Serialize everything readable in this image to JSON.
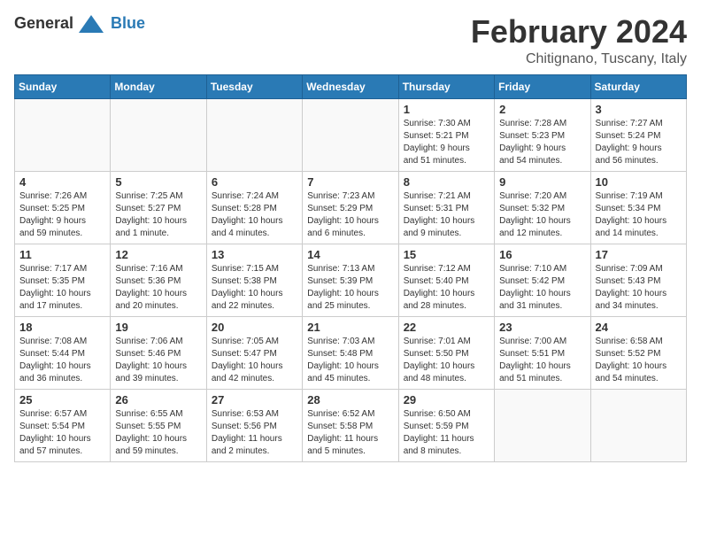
{
  "logo": {
    "general": "General",
    "blue": "Blue"
  },
  "header": {
    "month": "February 2024",
    "location": "Chitignano, Tuscany, Italy"
  },
  "weekdays": [
    "Sunday",
    "Monday",
    "Tuesday",
    "Wednesday",
    "Thursday",
    "Friday",
    "Saturday"
  ],
  "weeks": [
    [
      {
        "day": "",
        "info": ""
      },
      {
        "day": "",
        "info": ""
      },
      {
        "day": "",
        "info": ""
      },
      {
        "day": "",
        "info": ""
      },
      {
        "day": "1",
        "info": "Sunrise: 7:30 AM\nSunset: 5:21 PM\nDaylight: 9 hours\nand 51 minutes."
      },
      {
        "day": "2",
        "info": "Sunrise: 7:28 AM\nSunset: 5:23 PM\nDaylight: 9 hours\nand 54 minutes."
      },
      {
        "day": "3",
        "info": "Sunrise: 7:27 AM\nSunset: 5:24 PM\nDaylight: 9 hours\nand 56 minutes."
      }
    ],
    [
      {
        "day": "4",
        "info": "Sunrise: 7:26 AM\nSunset: 5:25 PM\nDaylight: 9 hours\nand 59 minutes."
      },
      {
        "day": "5",
        "info": "Sunrise: 7:25 AM\nSunset: 5:27 PM\nDaylight: 10 hours\nand 1 minute."
      },
      {
        "day": "6",
        "info": "Sunrise: 7:24 AM\nSunset: 5:28 PM\nDaylight: 10 hours\nand 4 minutes."
      },
      {
        "day": "7",
        "info": "Sunrise: 7:23 AM\nSunset: 5:29 PM\nDaylight: 10 hours\nand 6 minutes."
      },
      {
        "day": "8",
        "info": "Sunrise: 7:21 AM\nSunset: 5:31 PM\nDaylight: 10 hours\nand 9 minutes."
      },
      {
        "day": "9",
        "info": "Sunrise: 7:20 AM\nSunset: 5:32 PM\nDaylight: 10 hours\nand 12 minutes."
      },
      {
        "day": "10",
        "info": "Sunrise: 7:19 AM\nSunset: 5:34 PM\nDaylight: 10 hours\nand 14 minutes."
      }
    ],
    [
      {
        "day": "11",
        "info": "Sunrise: 7:17 AM\nSunset: 5:35 PM\nDaylight: 10 hours\nand 17 minutes."
      },
      {
        "day": "12",
        "info": "Sunrise: 7:16 AM\nSunset: 5:36 PM\nDaylight: 10 hours\nand 20 minutes."
      },
      {
        "day": "13",
        "info": "Sunrise: 7:15 AM\nSunset: 5:38 PM\nDaylight: 10 hours\nand 22 minutes."
      },
      {
        "day": "14",
        "info": "Sunrise: 7:13 AM\nSunset: 5:39 PM\nDaylight: 10 hours\nand 25 minutes."
      },
      {
        "day": "15",
        "info": "Sunrise: 7:12 AM\nSunset: 5:40 PM\nDaylight: 10 hours\nand 28 minutes."
      },
      {
        "day": "16",
        "info": "Sunrise: 7:10 AM\nSunset: 5:42 PM\nDaylight: 10 hours\nand 31 minutes."
      },
      {
        "day": "17",
        "info": "Sunrise: 7:09 AM\nSunset: 5:43 PM\nDaylight: 10 hours\nand 34 minutes."
      }
    ],
    [
      {
        "day": "18",
        "info": "Sunrise: 7:08 AM\nSunset: 5:44 PM\nDaylight: 10 hours\nand 36 minutes."
      },
      {
        "day": "19",
        "info": "Sunrise: 7:06 AM\nSunset: 5:46 PM\nDaylight: 10 hours\nand 39 minutes."
      },
      {
        "day": "20",
        "info": "Sunrise: 7:05 AM\nSunset: 5:47 PM\nDaylight: 10 hours\nand 42 minutes."
      },
      {
        "day": "21",
        "info": "Sunrise: 7:03 AM\nSunset: 5:48 PM\nDaylight: 10 hours\nand 45 minutes."
      },
      {
        "day": "22",
        "info": "Sunrise: 7:01 AM\nSunset: 5:50 PM\nDaylight: 10 hours\nand 48 minutes."
      },
      {
        "day": "23",
        "info": "Sunrise: 7:00 AM\nSunset: 5:51 PM\nDaylight: 10 hours\nand 51 minutes."
      },
      {
        "day": "24",
        "info": "Sunrise: 6:58 AM\nSunset: 5:52 PM\nDaylight: 10 hours\nand 54 minutes."
      }
    ],
    [
      {
        "day": "25",
        "info": "Sunrise: 6:57 AM\nSunset: 5:54 PM\nDaylight: 10 hours\nand 57 minutes."
      },
      {
        "day": "26",
        "info": "Sunrise: 6:55 AM\nSunset: 5:55 PM\nDaylight: 10 hours\nand 59 minutes."
      },
      {
        "day": "27",
        "info": "Sunrise: 6:53 AM\nSunset: 5:56 PM\nDaylight: 11 hours\nand 2 minutes."
      },
      {
        "day": "28",
        "info": "Sunrise: 6:52 AM\nSunset: 5:58 PM\nDaylight: 11 hours\nand 5 minutes."
      },
      {
        "day": "29",
        "info": "Sunrise: 6:50 AM\nSunset: 5:59 PM\nDaylight: 11 hours\nand 8 minutes."
      },
      {
        "day": "",
        "info": ""
      },
      {
        "day": "",
        "info": ""
      }
    ]
  ]
}
